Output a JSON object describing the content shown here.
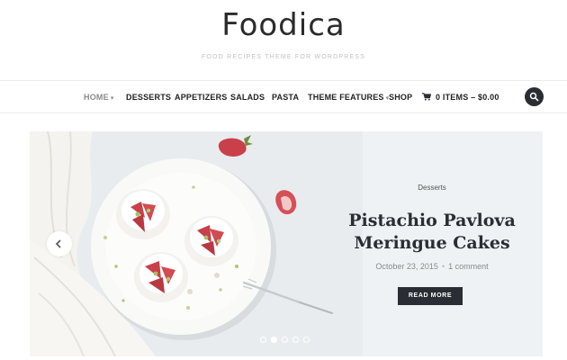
{
  "site": {
    "logo": "Foodica",
    "tagline": "FOOD RECIPES THEME FOR WORDPRESS"
  },
  "nav": {
    "items": [
      {
        "label": "HOME",
        "has_dropdown": true,
        "active": true
      },
      {
        "label": "DESSERTS"
      },
      {
        "label": "APPETIZERS"
      },
      {
        "label": "SALADS"
      },
      {
        "label": "PASTA"
      },
      {
        "label": "THEME FEATURES",
        "has_dropdown": true
      },
      {
        "label": "SHOP"
      }
    ],
    "cart": {
      "label": "0 ITEMS – $0.00",
      "icon": "cart-icon"
    },
    "search": {
      "icon": "search-icon"
    }
  },
  "slider": {
    "slide": {
      "category": "Desserts",
      "title_line1": "Pistachio Pavlova",
      "title_line2": "Meringue Cakes",
      "date": "October 23, 2015",
      "separator": "•",
      "comments": "1 comment",
      "button": "READ MORE"
    },
    "active_dot": 1,
    "dot_count": 5
  },
  "colors": {
    "accent_dark": "#2a2d33",
    "slide_bg": "#eff2f4",
    "berry": "#c9404a"
  }
}
